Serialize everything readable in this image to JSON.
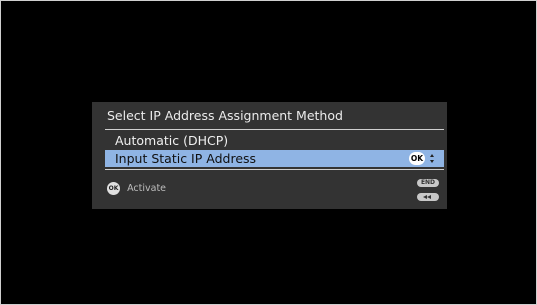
{
  "dialog": {
    "title": "Select IP Address Assignment Method",
    "items": [
      {
        "label": "Automatic (DHCP)",
        "selected": false
      },
      {
        "label": "Input Static IP Address",
        "selected": true
      }
    ],
    "selected_item_ok_icon": "OK",
    "footer": {
      "ok_icon": "OK",
      "activate_label": "Activate",
      "end_label": "END",
      "back_icon": "rewind-back-icon"
    }
  },
  "colors": {
    "screen_background": "#000000",
    "dialog_background": "#333333",
    "highlight": "#8fb4e4",
    "separator": "#cfcfcf"
  }
}
